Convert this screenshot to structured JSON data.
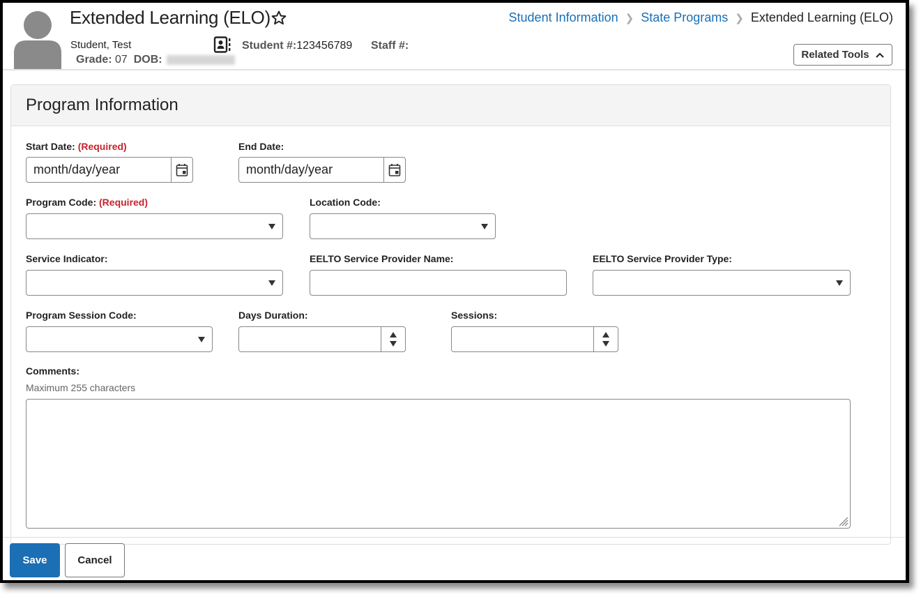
{
  "header": {
    "title": "Extended Learning (ELO)",
    "student_name": "Student, Test",
    "grade_label": "Grade:",
    "grade_value": "07",
    "dob_label": "DOB:",
    "student_num_label": "Student #:",
    "student_num_value": "123456789",
    "staff_num_label": "Staff #:",
    "related_tools_label": "Related Tools"
  },
  "breadcrumb": [
    {
      "label": "Student Information"
    },
    {
      "label": "State Programs"
    },
    {
      "label": "Extended Learning (ELO)"
    }
  ],
  "panel": {
    "title": "Program Information"
  },
  "form": {
    "required_text": "(Required)",
    "start_date": {
      "label": "Start Date:",
      "value": "month/day/year"
    },
    "end_date": {
      "label": "End Date:",
      "value": "month/day/year"
    },
    "program_code": {
      "label": "Program Code:",
      "value": ""
    },
    "location_code": {
      "label": "Location Code:",
      "value": ""
    },
    "service_indicator": {
      "label": "Service Indicator:",
      "value": ""
    },
    "provider_name": {
      "label": "EELTO Service Provider Name:",
      "value": ""
    },
    "provider_type": {
      "label": "EELTO Service Provider Type:",
      "value": ""
    },
    "session_code": {
      "label": "Program Session Code:",
      "value": ""
    },
    "days_duration": {
      "label": "Days Duration:",
      "value": ""
    },
    "sessions": {
      "label": "Sessions:",
      "value": ""
    },
    "comments": {
      "label": "Comments:",
      "help": "Maximum 255 characters",
      "value": ""
    }
  },
  "footer": {
    "save_label": "Save",
    "cancel_label": "Cancel"
  },
  "colors": {
    "accent": "#1b6fb5",
    "required": "#c8232c"
  }
}
